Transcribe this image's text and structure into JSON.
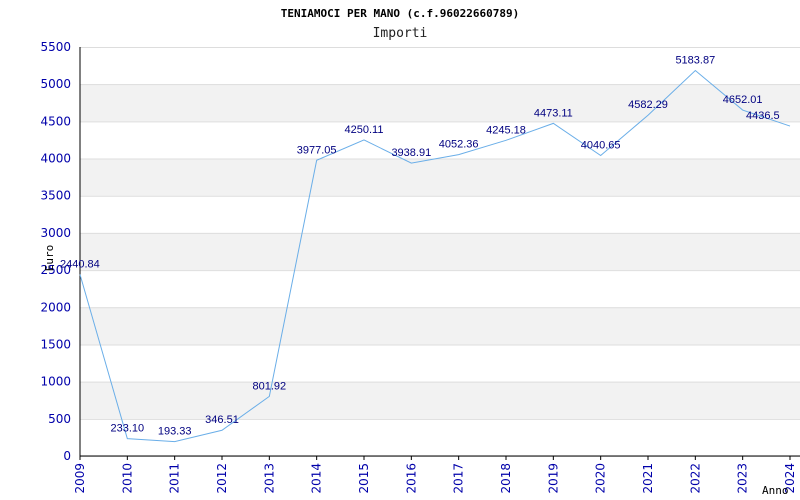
{
  "chart_data": {
    "type": "line",
    "title": "TENIAMOCI PER MANO (c.f.96022660789)",
    "subtitle": "Importi",
    "xlabel": "Anno",
    "ylabel": "Euro",
    "categories": [
      "2009",
      "2010",
      "2011",
      "2012",
      "2013",
      "2014",
      "2015",
      "2016",
      "2017",
      "2018",
      "2019",
      "2020",
      "2021",
      "2022",
      "2023",
      "2024"
    ],
    "series": [
      {
        "values": [
          2440.84,
          233.1,
          193.33,
          346.51,
          801.92,
          3977.05,
          4250.11,
          3938.91,
          4052.36,
          4245.18,
          4473.11,
          4040.65,
          4582.29,
          5183.87,
          4652.01,
          4436.5
        ]
      }
    ],
    "data_labels": [
      "2440.84",
      "233.10",
      "193.33",
      "346.51",
      "801.92",
      "3977.05",
      "4250.11",
      "3938.91",
      "4052.36",
      "4245.18",
      "4473.11",
      "4040.65",
      "4582.29",
      "5183.87",
      "4652.01",
      "4436.5"
    ],
    "yticks": [
      "0",
      "500",
      "1000",
      "1500",
      "2000",
      "2500",
      "3000",
      "3500",
      "4000",
      "4500",
      "5000",
      "5500"
    ],
    "ylim": [
      0,
      5500
    ],
    "grid": true,
    "colors": {
      "line": "#6aaee8",
      "band": "#f2f2f2",
      "gridline": "#dddddd",
      "axis": "#000000",
      "tick_text": "#0000aa",
      "label_text": "#000080"
    }
  }
}
